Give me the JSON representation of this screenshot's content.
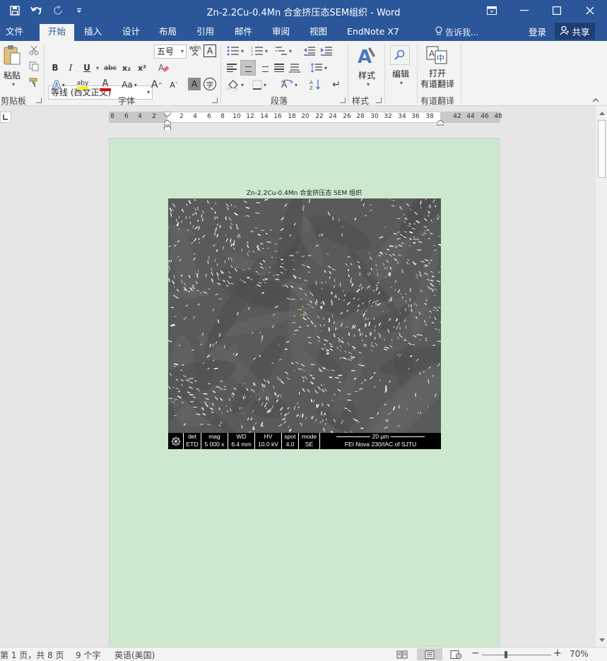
{
  "window": {
    "title": "Zn-2.2Cu-0.4Mn 合金挤压态SEM组织 - Word",
    "controls": [
      "ribbon-options-icon",
      "minimize-icon",
      "maximize-icon",
      "close-icon"
    ]
  },
  "quick_access": {
    "icons": [
      "save-icon",
      "undo-icon",
      "redo-icon",
      "customize-icon"
    ]
  },
  "tabs": [
    {
      "label": "文件",
      "active": false
    },
    {
      "label": "开始",
      "active": true
    },
    {
      "label": "插入",
      "active": false
    },
    {
      "label": "设计",
      "active": false
    },
    {
      "label": "布局",
      "active": false
    },
    {
      "label": "引用",
      "active": false
    },
    {
      "label": "邮件",
      "active": false
    },
    {
      "label": "审阅",
      "active": false
    },
    {
      "label": "视图",
      "active": false
    },
    {
      "label": "EndNote X7",
      "active": false
    }
  ],
  "tell_me": "告诉我...",
  "login": "登录",
  "share": "共享",
  "ribbon": {
    "clipboard": {
      "label": "剪贴板",
      "paste": "粘贴"
    },
    "font": {
      "label": "字体",
      "font_name": "等线 (西文正文)",
      "font_size": "五号",
      "phonetic": "wén",
      "bold": "B",
      "italic": "I",
      "underline": "U",
      "strike": "abc",
      "subscript": "x₂",
      "superscript": "x²",
      "text_effect": "A",
      "highlight": "aby",
      "font_color": "A",
      "change_case": "Aa",
      "grow": "A",
      "shrink": "A",
      "char_shading": "A",
      "enclose": "字"
    },
    "paragraph": {
      "label": "段落"
    },
    "styles": {
      "label": "样式",
      "button": "样式"
    },
    "editing": {
      "button": "编辑"
    },
    "youdao": {
      "label": "有道翻译",
      "button_line1": "打开",
      "button_line2": "有道翻译"
    }
  },
  "ruler": {
    "left_ticks": [
      "8",
      "6",
      "4",
      "2"
    ],
    "right_ticks": [
      "2",
      "4",
      "6",
      "8",
      "10",
      "12",
      "14",
      "16",
      "18",
      "20",
      "22",
      "24",
      "26",
      "28",
      "30",
      "32",
      "34",
      "36",
      "38",
      "42",
      "44",
      "46",
      "48"
    ]
  },
  "document": {
    "caption": "Zn-2.2Cu-0.4Mn  合金挤压态 SEM 组织",
    "sem": {
      "header": [
        "det",
        "mag",
        "WD",
        "HV",
        "spot",
        "mode"
      ],
      "values": [
        "ETD",
        "5 000 x",
        "6.4 mm",
        "10.0 kV",
        "4.0",
        "SE"
      ],
      "scale": "20 μm",
      "instrument": "FEI Nova 230/IAC of SJTU",
      "logo": "logo-icon"
    }
  },
  "status": {
    "page": "第 1 页，共 8 页",
    "words": "9 个字",
    "language": "英语(美国)",
    "zoom": "70%",
    "zoom_out": "−",
    "zoom_in": "+",
    "zoom_fraction": 0.35
  },
  "colors": {
    "brand": "#2b579a",
    "page": "#cce8cf",
    "sem_bg": "#5a5a5a"
  }
}
